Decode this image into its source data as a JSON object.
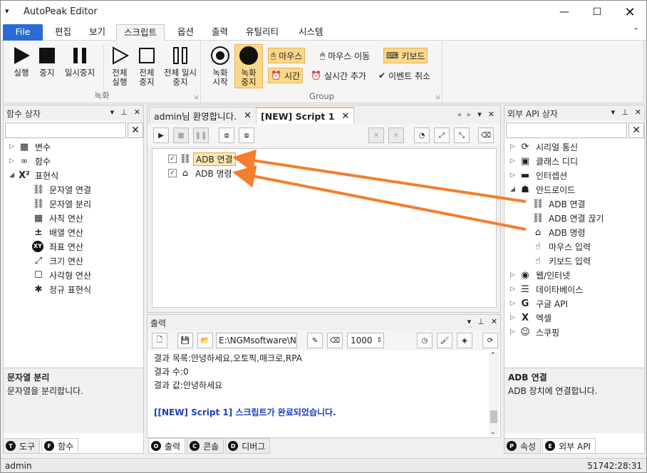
{
  "window": {
    "title": "AutoPeak Editor",
    "sysmenu_glyph": "▾",
    "min_glyph": "—",
    "max_glyph": "☐",
    "close_glyph": "✕"
  },
  "ribbon_tabs": [
    "File",
    "편집",
    "보기",
    "스크립트",
    "옵션",
    "출력",
    "유틸리티",
    "시스템"
  ],
  "ribbon_collapse_glyph": "⌃",
  "ribbon": {
    "record_group": {
      "label": "녹화",
      "buttons": [
        "실행",
        "중지",
        "일시중지",
        "전체 실행",
        "전체 중지",
        "전체 일시중지"
      ]
    },
    "group2": {
      "label": "Group",
      "big_buttons": [
        "녹화 시작",
        "녹화 중지"
      ],
      "small_buttons": [
        "마우스",
        "마우스 이동",
        "키보드",
        "시간",
        "실시간 추가",
        "이벤트 취소"
      ]
    },
    "launcher_glyph": "⇲"
  },
  "left_panel": {
    "title": "함수 상자",
    "header_buttons": [
      "▾",
      "⊥",
      "✕"
    ],
    "search_value": "",
    "clear_glyph": "✕",
    "items": [
      {
        "label": "변수",
        "icon": "variable-icon",
        "glyph": "▦",
        "expander": "▷"
      },
      {
        "label": "함수",
        "icon": "function-icon",
        "glyph": "∞",
        "expander": "▷"
      },
      {
        "label": "표현식",
        "icon": "expression-icon",
        "glyph": "X²",
        "expander": "◢"
      },
      {
        "label": "문자열 연결",
        "icon": "link-icon",
        "glyph": "⛓"
      },
      {
        "label": "문자열 분리",
        "icon": "unlink-icon",
        "glyph": "⛓"
      },
      {
        "label": "사칙 연산",
        "icon": "calculator-icon",
        "glyph": "▦"
      },
      {
        "label": "배열 연산",
        "icon": "plus-minus-icon",
        "glyph": "±"
      },
      {
        "label": "좌표 연산",
        "icon": "xy-icon",
        "glyph": "XY"
      },
      {
        "label": "크기 연산",
        "icon": "resize-icon",
        "glyph": "⤢"
      },
      {
        "label": "사각형 연산",
        "icon": "rectangle-icon",
        "glyph": "☐"
      },
      {
        "label": "정규 표현식",
        "icon": "asterisk-icon",
        "glyph": "✱"
      }
    ],
    "desc_title": "문자열 분리",
    "desc_text": "문자열을 분리합니다.",
    "bottom_tabs": [
      {
        "badge": "T",
        "label": "도구"
      },
      {
        "badge": "F",
        "label": "함수"
      }
    ]
  },
  "doc_tabs": {
    "tabs": [
      {
        "label": "admin님 환영합니다.",
        "close": "✕"
      },
      {
        "label": "[NEW] Script 1",
        "close": "✕"
      }
    ],
    "nav": [
      "◂",
      "▸",
      "▾",
      "✕"
    ]
  },
  "script_toolbar": {
    "glyphs": [
      "▶",
      "■",
      "❚❚",
      "⧈",
      "⧈",
      "✕",
      "✕",
      "◔",
      "⤢",
      "⤡",
      "⌫"
    ]
  },
  "script_tree": {
    "items": [
      {
        "label": "ADB 연결",
        "icon": "link-icon",
        "checked": "✓",
        "selected": true
      },
      {
        "label": "ADB 명령",
        "icon": "home-icon",
        "checked": "✓",
        "selected": false
      }
    ]
  },
  "output": {
    "title": "출력",
    "header_buttons": [
      "▾",
      "⊥",
      "✕"
    ],
    "path": "E:\\NGMsoftware\\NG",
    "line_limit": "1000",
    "stepper_glyph": "⇕",
    "lines": [
      "결과 목록:안녕하세요,오토픽,매크로,RPA",
      "결과 수:0",
      "결과 값:안녕하세요"
    ],
    "done_line": "[[NEW] Script 1] 스크립트가 완료되었습니다.",
    "scroll_up": "⌃",
    "scroll_down": "⌄",
    "bottom_tabs": [
      {
        "badge": "O",
        "label": "출력"
      },
      {
        "badge": "C",
        "label": "콘솔"
      },
      {
        "badge": "D",
        "label": "디버그"
      }
    ]
  },
  "right_panel": {
    "title": "외부 API 상자",
    "header_buttons": [
      "▾",
      "⊥",
      "✕"
    ],
    "search_value": "",
    "clear_glyph": "✕",
    "items": [
      {
        "label": "시리얼 통신",
        "icon": "serial-icon",
        "glyph": "⟳",
        "expander": "▷"
      },
      {
        "label": "클래스 디디",
        "icon": "class-icon",
        "glyph": "▣",
        "expander": "▷"
      },
      {
        "label": "인터셉션",
        "icon": "monitor-icon",
        "glyph": "▬",
        "expander": "▷"
      },
      {
        "label": "안드로이드",
        "icon": "android-icon",
        "glyph": "☗",
        "expander": "◢"
      },
      {
        "label": "ADB 연결",
        "icon": "link-icon",
        "glyph": "⛓"
      },
      {
        "label": "ADB 연결 끊기",
        "icon": "unlink-icon",
        "glyph": "⛓"
      },
      {
        "label": "ADB 명령",
        "icon": "home-icon",
        "glyph": "⌂"
      },
      {
        "label": "마우스 입력",
        "icon": "touch-icon",
        "glyph": "☝"
      },
      {
        "label": "키보드 입력",
        "icon": "touch-icon",
        "glyph": "☝"
      },
      {
        "label": "웹/인터넷",
        "icon": "globe-icon",
        "glyph": "◉",
        "expander": "▷"
      },
      {
        "label": "데이타베이스",
        "icon": "database-icon",
        "glyph": "☰",
        "expander": "▷"
      },
      {
        "label": "구글 API",
        "icon": "google-icon",
        "glyph": "G",
        "expander": "▷"
      },
      {
        "label": "엑셀",
        "icon": "excel-icon",
        "glyph": "X",
        "expander": "▷"
      },
      {
        "label": "스쿠핑",
        "icon": "mask-icon",
        "glyph": "☺",
        "expander": "▷"
      }
    ],
    "desc_title": "ADB 연결",
    "desc_text": "ADB 장치에 연결합니다.",
    "bottom_tabs": [
      {
        "badge": "P",
        "label": "속성"
      },
      {
        "badge": "E",
        "label": "외부 API"
      }
    ]
  },
  "statusbar": {
    "user": "admin",
    "time": "51742:28:31"
  },
  "colors": {
    "file_tab": "#2b6cd4",
    "highlight": "#fbd889",
    "arrow": "#f47e2c",
    "done_text": "#1a3ec2"
  }
}
